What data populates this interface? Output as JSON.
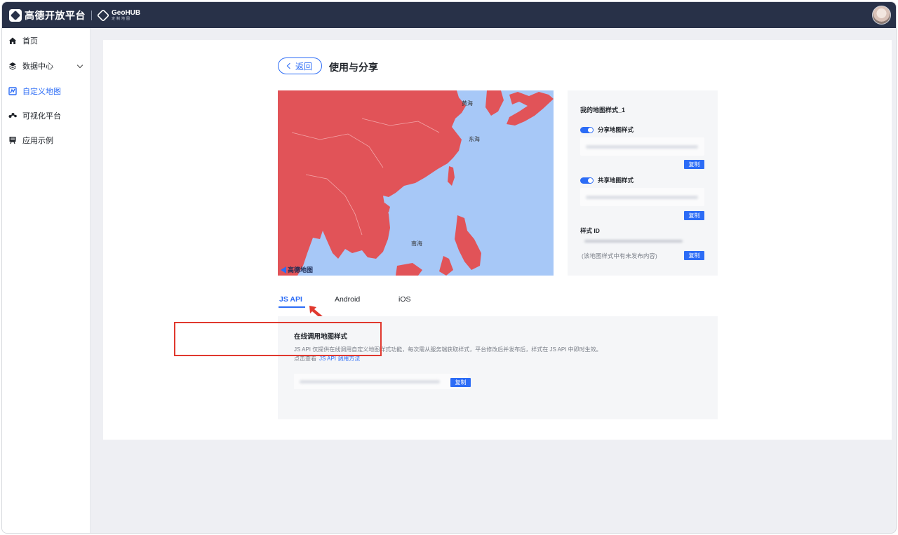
{
  "topbar": {
    "brand": "高德开放平台",
    "geohub_title": "GeoHUB",
    "geohub_sub": "定制地图"
  },
  "sidebar": {
    "items": [
      {
        "label": "首页",
        "icon": "home-icon"
      },
      {
        "label": "数据中心",
        "icon": "layers-icon"
      },
      {
        "label": "自定义地图",
        "icon": "custom-map-icon",
        "active": true
      },
      {
        "label": "可视化平台",
        "icon": "visualization-icon"
      },
      {
        "label": "应用示例",
        "icon": "app-example-icon"
      }
    ]
  },
  "header": {
    "back_label": "返回",
    "title": "使用与分享"
  },
  "map": {
    "labels": {
      "yellow_sea": "黄海",
      "east_sea": "东海",
      "south_sea": "南海"
    },
    "logo": "高德地图"
  },
  "info": {
    "title": "我的地图样式_1",
    "share_label": "分享地图样式",
    "common_label": "共享地图样式",
    "style_id_label": "样式 ID",
    "note": "(该地图样式中有未发布内容)",
    "copy_label": "复制"
  },
  "tabs": [
    {
      "label": "JS API",
      "active": true
    },
    {
      "label": "Android",
      "active": false
    },
    {
      "label": "iOS",
      "active": false
    }
  ],
  "jsapi": {
    "title": "在线调用地图样式",
    "desc": "JS API 仅提供在线调用自定义地图样式功能，每次需从服务端获取样式，平台修改后并发布后，样式在 JS API 中即时生效。",
    "see_prefix": "点击查看",
    "see_link": "JS API 调用方法",
    "copy_label": "复制"
  },
  "colors": {
    "accent": "#2c6cf6",
    "land": "#e15358",
    "sea": "#a7c8f7",
    "highlight": "#e0382e"
  }
}
